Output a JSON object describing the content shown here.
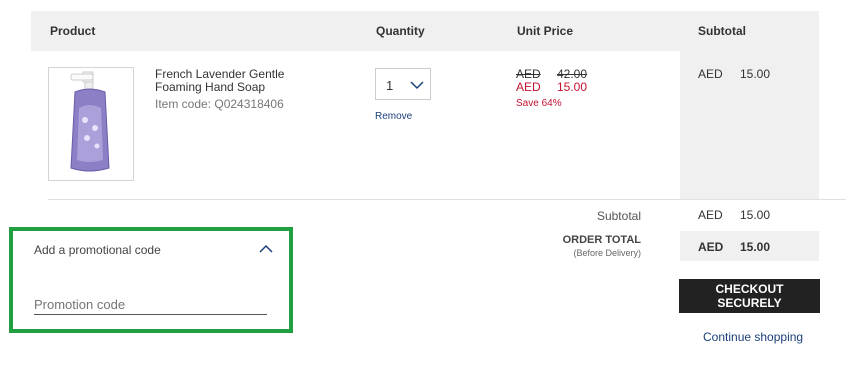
{
  "table": {
    "col_product": "Product",
    "col_quantity": "Quantity",
    "col_unit_price": "Unit Price",
    "col_subtotal": "Subtotal"
  },
  "item": {
    "name": "French Lavender Gentle Foaming Hand Soap",
    "code": "Item code: Q024318406",
    "quantity": "1",
    "remove_label": "Remove",
    "currency": "AED",
    "original_price": "42.00",
    "sale_price": "15.00",
    "save_text": "Save 64%",
    "subtotal_currency": "AED",
    "subtotal": "15.00"
  },
  "summary": {
    "subtotal_label": "Subtotal",
    "subtotal_currency": "AED",
    "subtotal_value": "15.00",
    "order_total_label": "ORDER TOTAL",
    "before_delivery": "(Before Delivery)",
    "total_currency": "AED",
    "total_value": "15.00"
  },
  "promo": {
    "title": "Add a promotional code",
    "placeholder": "Promotion code"
  },
  "actions": {
    "checkout_label": "CHECKOUT SECURELY",
    "continue_label": "Continue shopping"
  },
  "colors": {
    "accent_red": "#c41230",
    "link_blue": "#1a3f7a",
    "promo_border": "#20a040",
    "button_dark": "#222222"
  }
}
